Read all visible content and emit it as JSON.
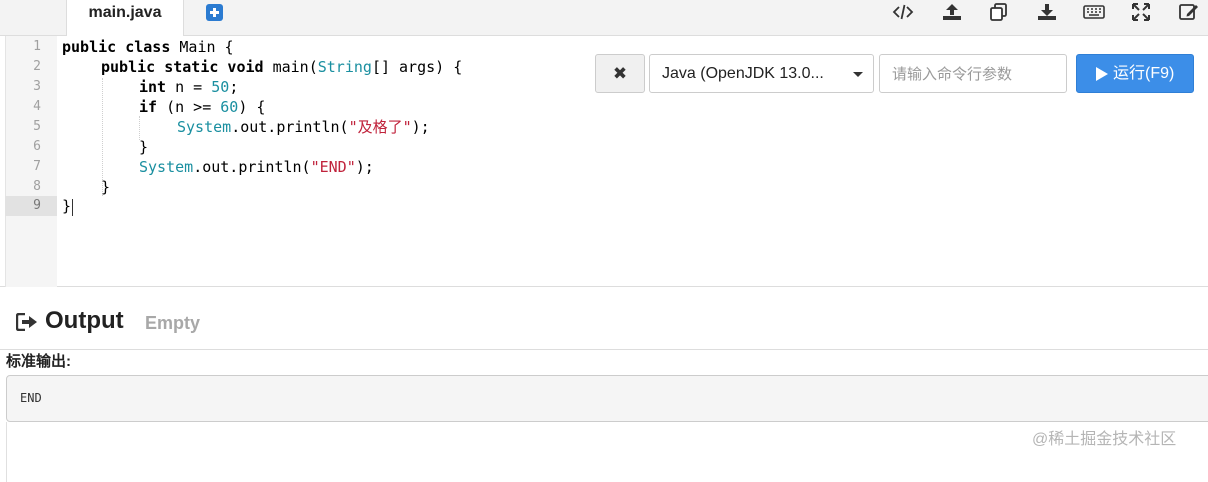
{
  "tabs": [
    {
      "label": "main.java"
    }
  ],
  "toolbar": {
    "icons": [
      "code-icon",
      "upload-icon",
      "copy-icon",
      "download-icon",
      "keyboard-icon",
      "fullscreen-icon",
      "edit-icon"
    ]
  },
  "editor": {
    "line_numbers": [
      "1",
      "2",
      "3",
      "4",
      "5",
      "6",
      "7",
      "8",
      "9"
    ],
    "active_line": 9,
    "lines": [
      {
        "l1": "public class",
        "l2": " Main {"
      },
      {
        "l1": "public static void",
        "l2": " main(",
        "l3": "String",
        "l4": "[] args) {"
      },
      {
        "l1": "int",
        "l2": " n = ",
        "l3": "50",
        "l4": ";"
      },
      {
        "l1": "if",
        "l2": " (n >= ",
        "l3": "60",
        "l4": ") {"
      },
      {
        "l1": "System",
        "l2": ".out.println(",
        "l3": "\"及格了\"",
        "l4": ");"
      },
      {
        "l1": "}"
      },
      {
        "l1": "System",
        "l2": ".out.println(",
        "l3": "\"END\"",
        "l4": ");"
      },
      {
        "l1": "}"
      },
      {
        "l1": "}"
      }
    ]
  },
  "controls": {
    "clear_label": "✖",
    "language": "Java (OpenJDK 13.0...",
    "args_placeholder": "请输入命令行参数",
    "run_label": "运行(F9)"
  },
  "output": {
    "title": "Output",
    "status": "Empty",
    "stdout_label": "标准输出:",
    "stdout_value": "END"
  },
  "watermark": "@稀土掘金技术社区",
  "colors": {
    "run_button": "#3c8ee8",
    "keyword": "#000000",
    "number": "#1a8fa0",
    "string": "#c0223b"
  }
}
